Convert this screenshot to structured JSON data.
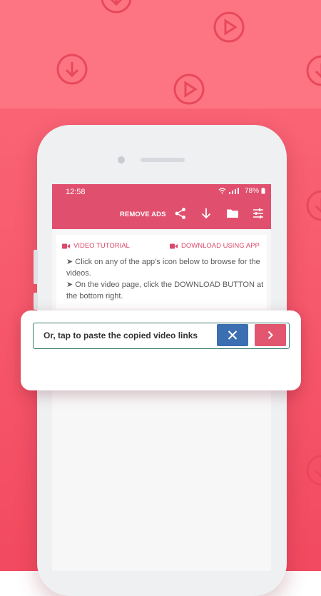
{
  "status": {
    "time": "12:58",
    "battery": "78%"
  },
  "toolbar": {
    "remove_ads_label": "REMOVE ADS"
  },
  "links": {
    "video_tutorial": "VIDEO TUTORIAL",
    "download_using_app": "DOWNLOAD USING APP"
  },
  "instructions": {
    "line1": "➤ Click on any of the app's icon below to browse for the videos.",
    "line2": "➤ On the video page, click the DOWNLOAD BUTTON at the bottom right."
  },
  "paste": {
    "placeholder": "Or, tap to paste the copied video links"
  },
  "colors": {
    "accent": "#e0506e",
    "clear_button": "#3b6fb1",
    "go_button": "#e2566f",
    "background": "#f6566a"
  },
  "icons": [
    "share-icon",
    "download-icon",
    "folder-icon",
    "settings-sliders-icon",
    "video-camera-icon",
    "close-icon",
    "chevron-right-icon"
  ]
}
